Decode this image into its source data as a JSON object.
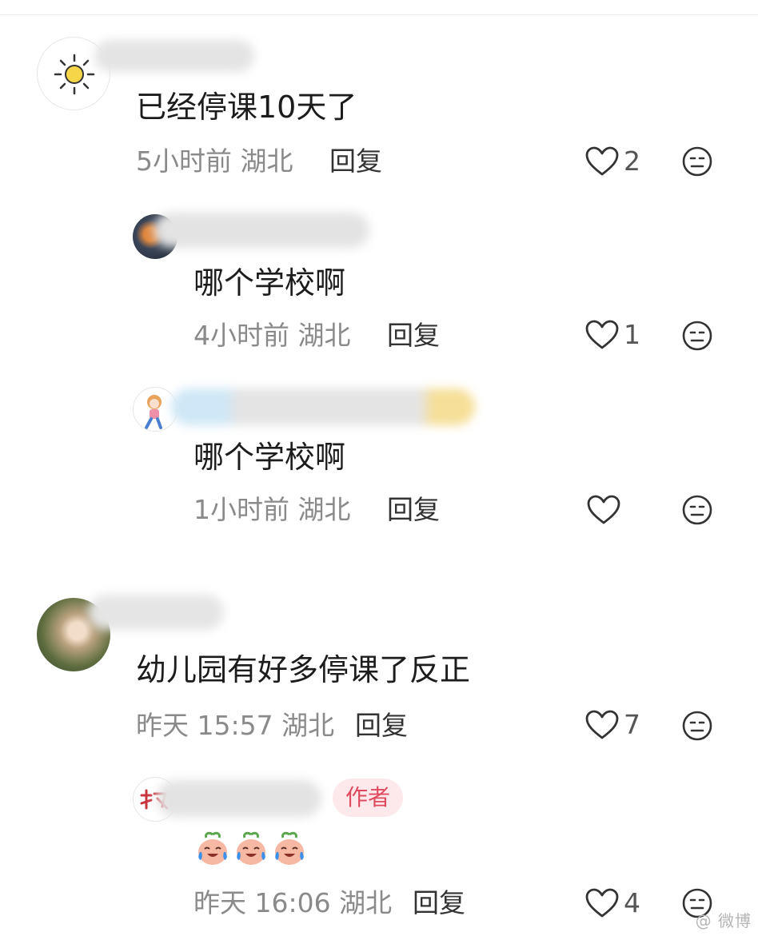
{
  "comments": [
    {
      "text": "已经停课10天了",
      "time": "5小时前",
      "location": "湖北",
      "reply_label": "回复",
      "likes": "2",
      "replies": [
        {
          "text": "哪个学校啊",
          "time": "4小时前",
          "location": "湖北",
          "reply_label": "回复",
          "likes": "1"
        },
        {
          "text": "哪个学校啊",
          "time": "1小时前",
          "location": "湖北",
          "reply_label": "回复",
          "likes": ""
        }
      ]
    },
    {
      "text": "幼儿园有好多停课了反正",
      "time": "昨天 15:57",
      "location": "湖北",
      "reply_label": "回复",
      "likes": "7",
      "replies": [
        {
          "author_badge": "作者",
          "text": "",
          "emojis": [
            "crying-laughing-peach-emoji",
            "crying-laughing-peach-emoji",
            "crying-laughing-peach-emoji"
          ],
          "time": "昨天 16:06",
          "location": "湖北",
          "reply_label": "回复",
          "likes": "4"
        }
      ]
    }
  ],
  "icons": {
    "like": "heart-outline-icon",
    "dislike": "meh-face-icon"
  },
  "colors": {
    "meta_gray": "#8a8a8a",
    "author_badge_bg": "#fde9ec",
    "author_badge_text": "#e04a5e"
  },
  "watermark": "@ 微博"
}
